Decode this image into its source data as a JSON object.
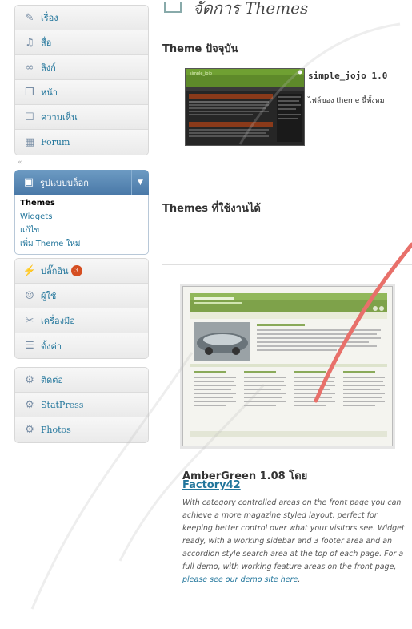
{
  "sidebar": {
    "group1": [
      {
        "label": "เรื่อง",
        "icon": "pin-icon"
      },
      {
        "label": "สื่อ",
        "icon": "media-icon"
      },
      {
        "label": "ลิงก์",
        "icon": "link-icon"
      },
      {
        "label": "หน้า",
        "icon": "page-icon"
      },
      {
        "label": "ความเห็น",
        "icon": "comment-icon"
      },
      {
        "label": "Forum",
        "icon": "forum-icon"
      }
    ],
    "appearance": {
      "label": "รูปแบบบล็อก",
      "submenu": [
        "Themes",
        "Widgets",
        "แก้ไข",
        "เพิ่ม Theme ใหม่"
      ]
    },
    "group2": [
      {
        "label": "ปลั๊กอิน",
        "icon": "plugin-icon",
        "badge": "3"
      },
      {
        "label": "ผู้ใช้",
        "icon": "users-icon"
      },
      {
        "label": "เครื่องมือ",
        "icon": "tools-icon"
      },
      {
        "label": "ตั้งค่า",
        "icon": "settings-icon"
      }
    ],
    "group3": [
      {
        "label": "ติดต่อ",
        "icon": "contact-icon"
      },
      {
        "label": "StatPress",
        "icon": "statpress-icon"
      },
      {
        "label": "Photos",
        "icon": "photos-icon"
      }
    ]
  },
  "main": {
    "page_title": "จัดการ Themes",
    "current_heading": "Theme ปัจจุบัน",
    "current_name": "simple_jojo 1.0",
    "current_desc": "ไฟล์ของ theme นี้ทั้งหม",
    "available_heading": "Themes ที่ใช้งานได้",
    "theme_title": "AmberGreen 1.08 โดย",
    "theme_author": "Factory42",
    "theme_desc": "With category controlled areas on the front page you can achieve a more magazine styled layout, perfect for keeping better control over what your visitors see. Widget ready, with a working sidebar and 3 footer area and an accordion style search area at the top of each page. For a full demo, with working feature areas on the front page, ",
    "theme_desc_link": "please see our demo site here",
    "theme_desc_end": "."
  },
  "colors": {
    "link": "#21759b",
    "active_menu": "#4a79a8",
    "badge": "#d54e21",
    "annotation": "#e8706a"
  }
}
